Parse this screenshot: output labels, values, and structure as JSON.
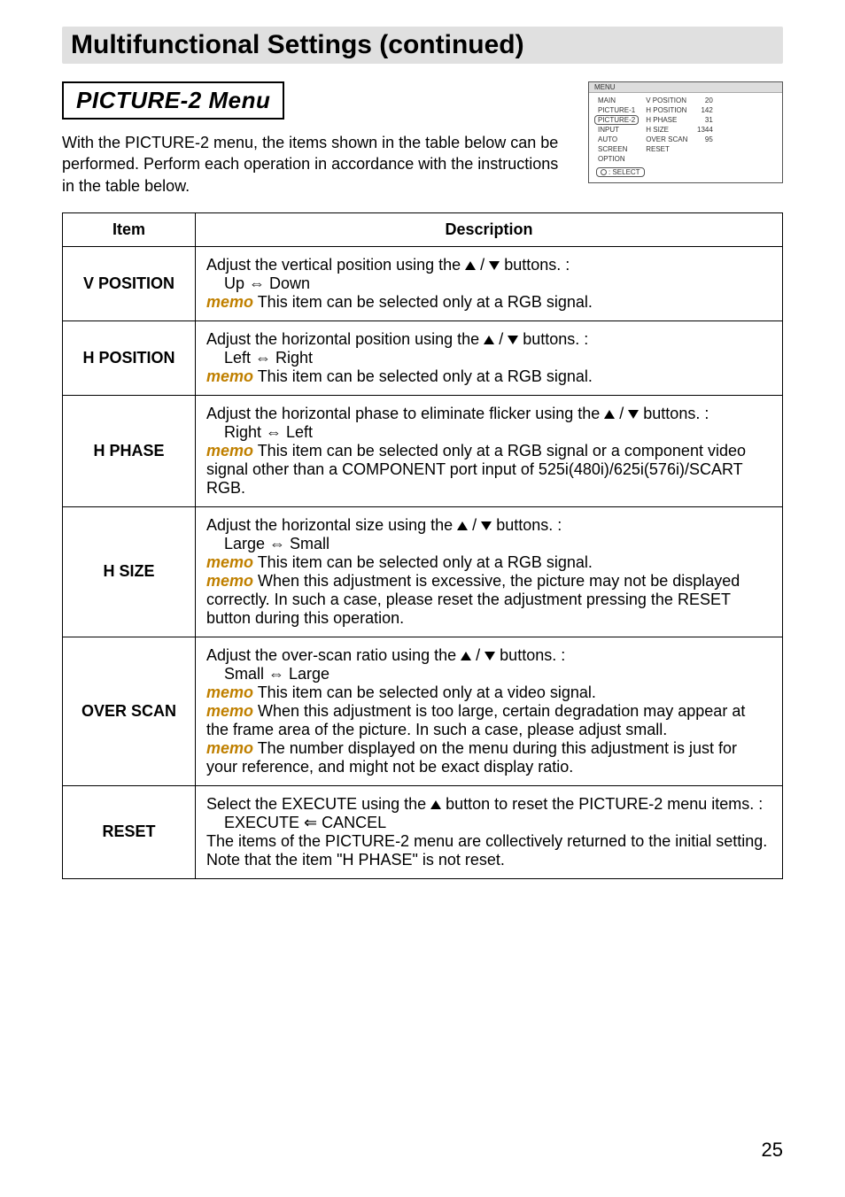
{
  "page_title": "Multifunctional Settings (continued)",
  "section_heading": "PICTURE-2 Menu",
  "intro_text": "With the PICTURE-2 menu, the items shown in the table below can be performed. Perform each operation in accordance with the instructions in the table below.",
  "osd": {
    "header": "MENU",
    "categories": [
      "MAIN",
      "PICTURE-1",
      "PICTURE-2",
      "INPUT",
      "AUTO",
      "SCREEN",
      "OPTION"
    ],
    "selected_category": "PICTURE-2",
    "params": [
      {
        "label": "V POSITION",
        "value": "20"
      },
      {
        "label": "H POSITION",
        "value": "142"
      },
      {
        "label": "H PHASE",
        "value": "31"
      },
      {
        "label": "H SIZE",
        "value": "1344"
      },
      {
        "label": "OVER SCAN",
        "value": "95"
      },
      {
        "label": "RESET",
        "value": ""
      }
    ],
    "footer": ": SELECT"
  },
  "table": {
    "headers": {
      "item": "Item",
      "desc": "Description"
    },
    "rows": [
      {
        "item": "V POSITION",
        "line1_pre": "Adjust the vertical position using the ",
        "line1_post": " buttons. :",
        "line2_indent": "Up ",
        "line2_end": " Down",
        "memo1_text": " This item can be selected only at a RGB signal."
      },
      {
        "item": "H POSITION",
        "line1_pre": "Adjust the horizontal position using the ",
        "line1_post": " buttons. :",
        "line2_indent": "Left ",
        "line2_end": " Right",
        "memo1_text": " This item can be selected only at a RGB signal."
      },
      {
        "item": "H PHASE",
        "line1_pre": "Adjust the horizontal phase to eliminate flicker using the ",
        "line1_post": " buttons. :",
        "line2_indent": "Right ",
        "line2_end": " Left",
        "memo1_text": " This item can be selected only at a RGB signal or a component video signal other than a COMPONENT port input of 525i(480i)/625i(576i)/SCART RGB."
      },
      {
        "item": "H SIZE",
        "line1_pre": "Adjust the horizontal size using the ",
        "line1_post": " buttons. :",
        "line2_indent": "Large ",
        "line2_end": " Small",
        "memo1_text": " This item can be selected only at a RGB signal.",
        "memo2_text": " When this adjustment is excessive, the picture may not be displayed correctly. In such a case, please reset the adjustment pressing the RESET button during this operation."
      },
      {
        "item": "OVER SCAN",
        "line1_pre": "Adjust the over-scan ratio using the ",
        "line1_post": " buttons. :",
        "line2_indent": "Small ",
        "line2_end": " Large",
        "memo1_text": " This item can be selected only at a video signal.",
        "memo2_text": " When this adjustment is too large, certain degradation may appear at the frame area of the picture. In such a case, please adjust small.",
        "memo3_text": " The number displayed on the menu during this adjustment is just for your reference, and might not be exact display ratio."
      },
      {
        "item": "RESET",
        "line1_pre": "Select the EXECUTE using the ",
        "line1_post": " button to reset the PICTURE-2 menu items. :",
        "line2_indent": "EXECUTE ",
        "line2_end": " CANCEL",
        "tail1": "The items of the PICTURE-2 menu are collectively returned to the initial setting.",
        "tail2": "Note that the item \"H PHASE\" is not reset."
      }
    ]
  },
  "memo_label": "memo",
  "page_number": "25"
}
